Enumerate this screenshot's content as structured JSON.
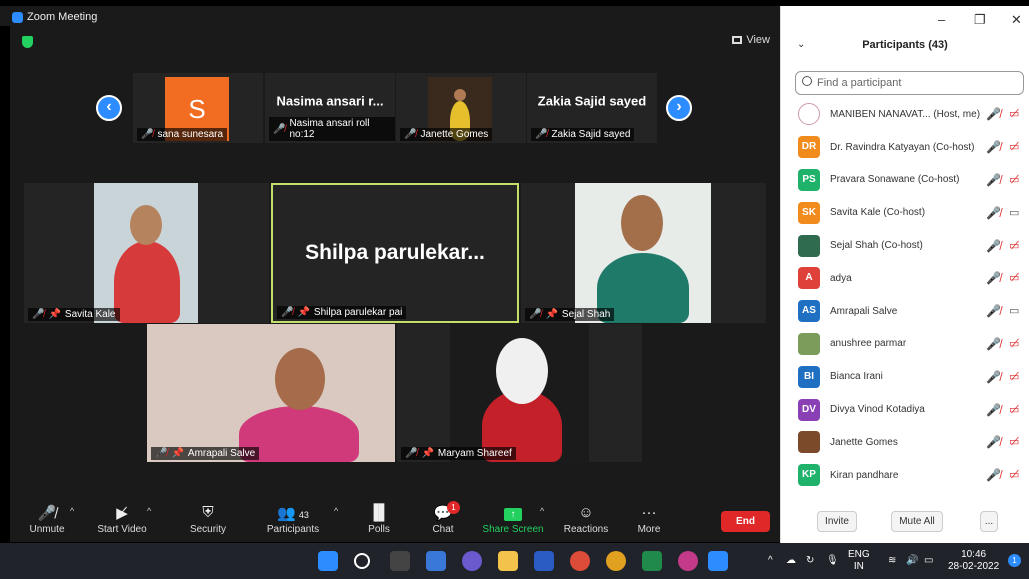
{
  "window": {
    "title": "Zoom Meeting"
  },
  "view_label": "View",
  "top_strip": [
    {
      "name": "sana sunesara",
      "avatar_letter": "S",
      "muted": true
    },
    {
      "name": "Nasima ansari roll no:12",
      "display": "Nasima ansari r...",
      "muted": true
    },
    {
      "name": "Janette Gomes",
      "muted": true
    },
    {
      "name": "Zakia Sajid sayed",
      "display": "Zakia Sajid sayed",
      "muted": true
    }
  ],
  "gallery": [
    {
      "name": "Savita Kale",
      "muted": true,
      "pinned": true
    },
    {
      "name": "Shilpa parulekar pai",
      "display": "Shilpa  parulekar...",
      "muted": true,
      "pinned": true,
      "active_speaker": true
    },
    {
      "name": "Sejal Shah",
      "muted": true,
      "pinned": true
    },
    {
      "name": "Amrapali Salve",
      "muted": true,
      "pinned": true
    },
    {
      "name": "Maryam Shareef",
      "muted": true,
      "pinned": true
    }
  ],
  "toolbar": {
    "unmute": "Unmute",
    "start_video": "Start Video",
    "security": "Security",
    "participants": "Participants",
    "participants_count": "43",
    "polls": "Polls",
    "chat": "Chat",
    "chat_badge": "1",
    "share_screen": "Share Screen",
    "reactions": "Reactions",
    "more": "More",
    "end": "End"
  },
  "panel": {
    "title": "Participants (43)",
    "search_placeholder": "Find a participant",
    "participants": [
      {
        "initials": "",
        "name": "MANIBEN NANAVAT... (Host, me)",
        "color": "#ffffff",
        "video": "off"
      },
      {
        "initials": "DR",
        "name": "Dr. Ravindra Katyayan (Co-host)",
        "color": "#f28b1e",
        "video": "off"
      },
      {
        "initials": "PS",
        "name": "Pravara Sonawane (Co-host)",
        "color": "#1fb26b",
        "video": "off"
      },
      {
        "initials": "SK",
        "name": "Savita Kale (Co-host)",
        "color": "#f28b1e",
        "video": "on"
      },
      {
        "initials": "",
        "name": "Sejal Shah (Co-host)",
        "color": "#2f6b4f",
        "video": "off"
      },
      {
        "initials": "A",
        "name": "adya",
        "color": "#e0403a",
        "video": "off"
      },
      {
        "initials": "AS",
        "name": "Amrapali Salve",
        "color": "#1f6fc2",
        "video": "on"
      },
      {
        "initials": "",
        "name": "anushree parmar",
        "color": "#7b9c5a",
        "video": "off"
      },
      {
        "initials": "BI",
        "name": "Bianca Irani",
        "color": "#1f6fc2",
        "video": "off"
      },
      {
        "initials": "DV",
        "name": "Divya Vinod Kotadiya",
        "color": "#8a3fb5",
        "video": "off"
      },
      {
        "initials": "",
        "name": "Janette Gomes",
        "color": "#7a4a2a",
        "video": "off"
      },
      {
        "initials": "KP",
        "name": "Kiran pandhare",
        "color": "#1fb26b",
        "video": "off"
      }
    ],
    "invite": "Invite",
    "mute_all": "Mute All",
    "more": "..."
  },
  "taskbar": {
    "lang": "ENG",
    "region": "IN",
    "time": "10:46",
    "date": "28-02-2022",
    "notification_count": "1"
  }
}
